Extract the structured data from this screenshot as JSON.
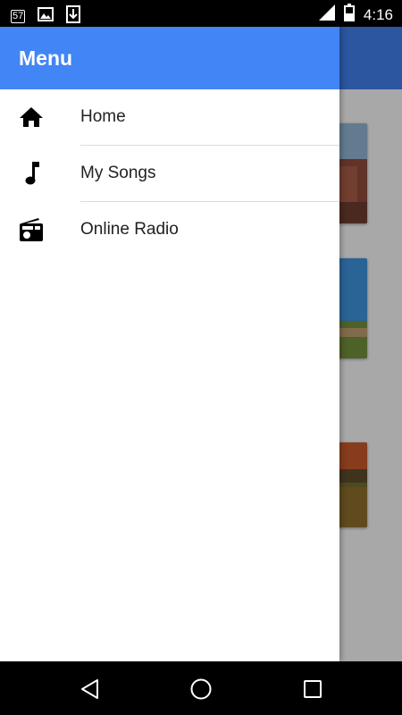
{
  "status_bar": {
    "time": "4:16",
    "notification_badge": "57",
    "left_icons": [
      "notification-count-icon",
      "image-icon",
      "download-icon"
    ],
    "right_icons": [
      "signal-icon",
      "battery-icon"
    ]
  },
  "drawer": {
    "title": "Menu",
    "items": [
      {
        "label": "Home",
        "icon": "home-icon"
      },
      {
        "label": "My Songs",
        "icon": "music-note-icon"
      },
      {
        "label": "Online Radio",
        "icon": "radio-icon"
      }
    ]
  },
  "navigation_bar": {
    "buttons": [
      "back-icon",
      "home-circle-icon",
      "recents-square-icon"
    ]
  },
  "colors": {
    "app_bar": "#3f7be6",
    "drawer_header": "#4285f4",
    "drawer_bg": "#ffffff",
    "status_bar": "#000000"
  }
}
